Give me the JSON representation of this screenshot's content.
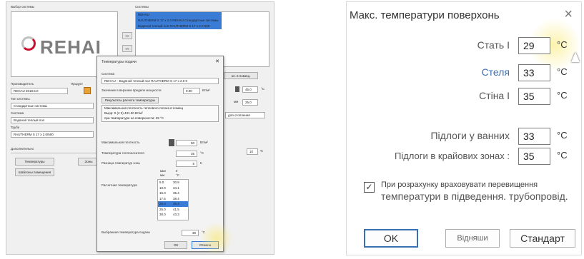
{
  "left": {
    "system_select_label": "Выбор системы",
    "systems_label": "Системы",
    "systems_list": [
      "REHAU",
      "RAUTHERM S 17 x 2.0 REHAU Стандартные системы",
      "Водяной теплый пол RAUTHERM S 17 x 2.0 500"
    ],
    "logo_text": "REHAI",
    "add_button": ">>",
    "remove_button": "<<",
    "manufacturer_label": "Производитель",
    "product_label": "Продукт",
    "manufacturer_value": "REHAU 2018.5.0",
    "system_type_label": "Тип системы",
    "system_type_value": "Стандартные системы",
    "system_label": "Система",
    "system_value": "Водяной теплый пол",
    "pipe_label": "Труба",
    "pipe_value": "RAUTHERM S 17 x 2.0/500",
    "tab_extra": "Дополнительно",
    "tab_temps": "Температуры",
    "tab_floor_templates": "Шаблоны помещения",
    "tab_heating": "Зоны",
    "right_button": "ол. в помещ.",
    "right_field_value": "45.0",
    "right_field_unit": "°C",
    "right_field2_label": "мм",
    "right_field2_value": "25.0",
    "right_dropdown": "для отопления",
    "right_small_value": "10",
    "right_small_unit": "%"
  },
  "dialog": {
    "title": "Температуры подачи",
    "close": "✕",
    "system_label": "Система",
    "system_value": "REHAU – Водяной теплый пол RAUTHERM S 17 x 2.0 0",
    "limit_label": "Значение в верхнем пределе мощности",
    "limit_value": "0.00",
    "limit_unit": "Вт/м²",
    "results_button": "Результаты расчета температуры",
    "results_text_1": "Максимальная плотность теплового потока в помещ",
    "results_text_2": "Вырр: 0 (2 3) 431.30 Вт/м²",
    "results_text_3": "при температуре на поверхности: 29 °C",
    "max_density_label": "Максимальная плотность",
    "max_density_value": "50",
    "max_density_unit": "Вт/м²",
    "temp_diff_label": "Температура теплоносителя",
    "temp_diff_value": "35",
    "temp_diff_unit": "°C",
    "spread_label": "Разница температур зоны",
    "spread_value": "5",
    "spread_unit": "K",
    "col_head_1": "Шаг",
    "col_head_2": "tг",
    "col_unit_1": "мм",
    "col_unit_2": "°C",
    "flow_temp_label": "Расчетная температура",
    "table": [
      [
        "5.0",
        "30.9"
      ],
      [
        "10.0",
        "34.1"
      ],
      [
        "15.0",
        "35.4"
      ],
      [
        "17.5",
        "38.4"
      ],
      [
        "20.0",
        "39.4"
      ],
      [
        "25.0",
        "41.5"
      ],
      [
        "30.0",
        "43.3"
      ]
    ],
    "selected_row": 4,
    "chosen_label": "Выбранная температура подачи",
    "chosen_value": "39",
    "chosen_unit": "°C",
    "ok_button": "ОК",
    "cancel_button": "Отмена"
  },
  "right": {
    "title": "Макс. температури поверхонь",
    "close": "×",
    "rows": [
      {
        "label": "Стать I",
        "value": "29",
        "unit": "°С"
      },
      {
        "label": "Стеля",
        "value": "33",
        "unit": "°С"
      },
      {
        "label": "Стіна  I",
        "value": "35",
        "unit": "°С"
      },
      {
        "label": "Підлоги у ванних",
        "value": "33",
        "unit": "°С"
      },
      {
        "label": "Підлоги в крайових зонах :",
        "value": "35",
        "unit": "°С"
      }
    ],
    "checkbox_checked": true,
    "checkbox_line1": "При розрахунку враховувати перевищення",
    "checkbox_line2": "температури в підведення. трубопровід.",
    "ok_button": "OK",
    "cancel_button": "Відняши",
    "standard_button": "Стандарт"
  }
}
